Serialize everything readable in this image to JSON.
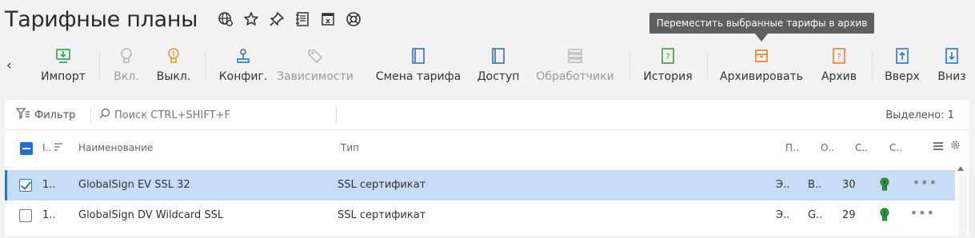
{
  "page": {
    "title": "Тарифные планы"
  },
  "header_icons": [
    "globe-settings-icon",
    "star-icon",
    "pin-icon",
    "notes-icon",
    "excel-icon",
    "help-lifebuoy-icon"
  ],
  "tooltip": {
    "text": "Переместить выбранные тарифы в архив"
  },
  "toolbar": {
    "import": "Импорт",
    "enable": "Вкл.",
    "disable": "Выкл.",
    "config": "Конфиг.",
    "dependencies": "Зависимости",
    "change_tariff": "Смена тарифа",
    "access": "Доступ",
    "handlers": "Обработчики",
    "history": "История",
    "archive_action": "Архивировать",
    "archive": "Архив",
    "up": "Вверх",
    "down": "Вниз"
  },
  "filterbar": {
    "filter_label": "Фильтр",
    "search_placeholder": "Поиск CTRL+SHIFT+F",
    "selected": "Выделено: 1"
  },
  "table": {
    "columns": {
      "id": "I..",
      "name": "Наименование",
      "type": "Тип",
      "c1": "П..",
      "c2": "О..",
      "c3": "С..",
      "c4": "С.."
    },
    "rows": [
      {
        "id": "1..",
        "name": "GlobalSign EV SSL 32",
        "type": "SSL сертификат",
        "c1": "Э..",
        "c2": "В..",
        "c3": "30",
        "more": "•••",
        "selected": true
      },
      {
        "id": "1..",
        "name": "GlobalSign DV Wildcard SSL",
        "type": "SSL сертификат",
        "c1": "Э..",
        "c2": "G..",
        "c3": "29",
        "more": "•••",
        "selected": false
      }
    ]
  },
  "colors": {
    "accent": "#1e6fd9",
    "selected_row": "#c7ddf7",
    "import_green": "#2aa34a",
    "bulb_orange": "#f29a1f",
    "doc_blue": "#2a74d6",
    "history_green": "#3aa03a",
    "archive_orange": "#ef7c2a",
    "tooltip_bg": "#5f5f5f"
  }
}
